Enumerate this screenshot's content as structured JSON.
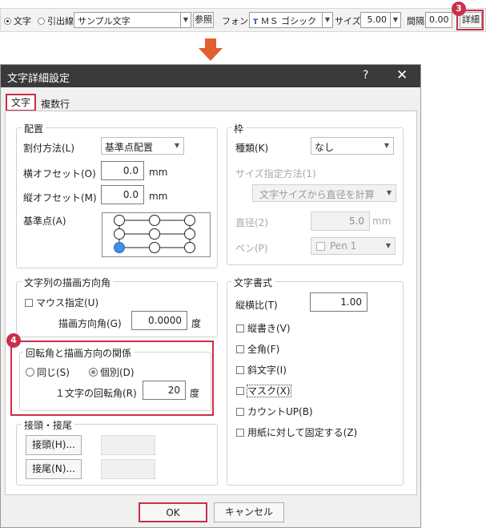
{
  "toolbar": {
    "radio_text": "文字",
    "radio_leader": "引出線",
    "sample_text": "サンプル文字",
    "ref_button": "参照",
    "font_label": "フォント",
    "font_value": "ＭＳ ゴシック",
    "size_label": "サイズ",
    "size_value": "5.00",
    "spacing_label": "間隔",
    "spacing_value": "0.00",
    "detail_button": "詳細",
    "badge": "3"
  },
  "dialog": {
    "title": "文字詳細設定",
    "help": "?",
    "close": "✕",
    "tabs": [
      "文字",
      "複数行"
    ],
    "placement": {
      "title": "配置",
      "method_label": "割付方法(L)",
      "method_value": "基準点配置",
      "hoffset_label": "横オフセット(O)",
      "hoffset_value": "0.0",
      "hoffset_unit": "mm",
      "voffset_label": "縦オフセット(M)",
      "voffset_value": "0.0",
      "voffset_unit": "mm",
      "anchor_label": "基準点(A)"
    },
    "frame": {
      "title": "枠",
      "type_label": "種類(K)",
      "type_value": "なし",
      "size_method_label": "サイズ指定方法(1)",
      "size_method_value": "文字サイズから直径を計算",
      "diameter_label": "直径(2)",
      "diameter_value": "5.0",
      "diameter_unit": "mm",
      "pen_label": "ペン(P)",
      "pen_value": "Pen 1"
    },
    "direction": {
      "title": "文字列の描画方向角",
      "mouse_label": "マウス指定(U)",
      "angle_label": "描画方向角(G)",
      "angle_value": "0.0000",
      "angle_unit": "度"
    },
    "rotation": {
      "badge": "4",
      "title": "回転角と描画方向の関係",
      "same_label": "同じ(S)",
      "individual_label": "個別(D)",
      "char_angle_label": "１文字の回転角(R)",
      "char_angle_value": "20",
      "char_angle_unit": "度"
    },
    "style": {
      "title": "文字書式",
      "ratio_label": "縦横比(T)",
      "ratio_value": "1.00",
      "checks": [
        "縦書き(V)",
        "全角(F)",
        "斜文字(I)",
        "マスク(X)",
        "カウントUP(B)",
        "用紙に対して固定する(Z)"
      ]
    },
    "affix": {
      "title": "接頭・接尾",
      "prefix_button": "接頭(H)...",
      "suffix_button": "接尾(N)..."
    },
    "ok_button": "OK",
    "cancel_button": "キャンセル"
  },
  "colors": {
    "accent": "#c8304a",
    "arrow": "#e06030",
    "anchor_selected": "#3d8fe0",
    "titlebar": "#3a3a3a"
  }
}
